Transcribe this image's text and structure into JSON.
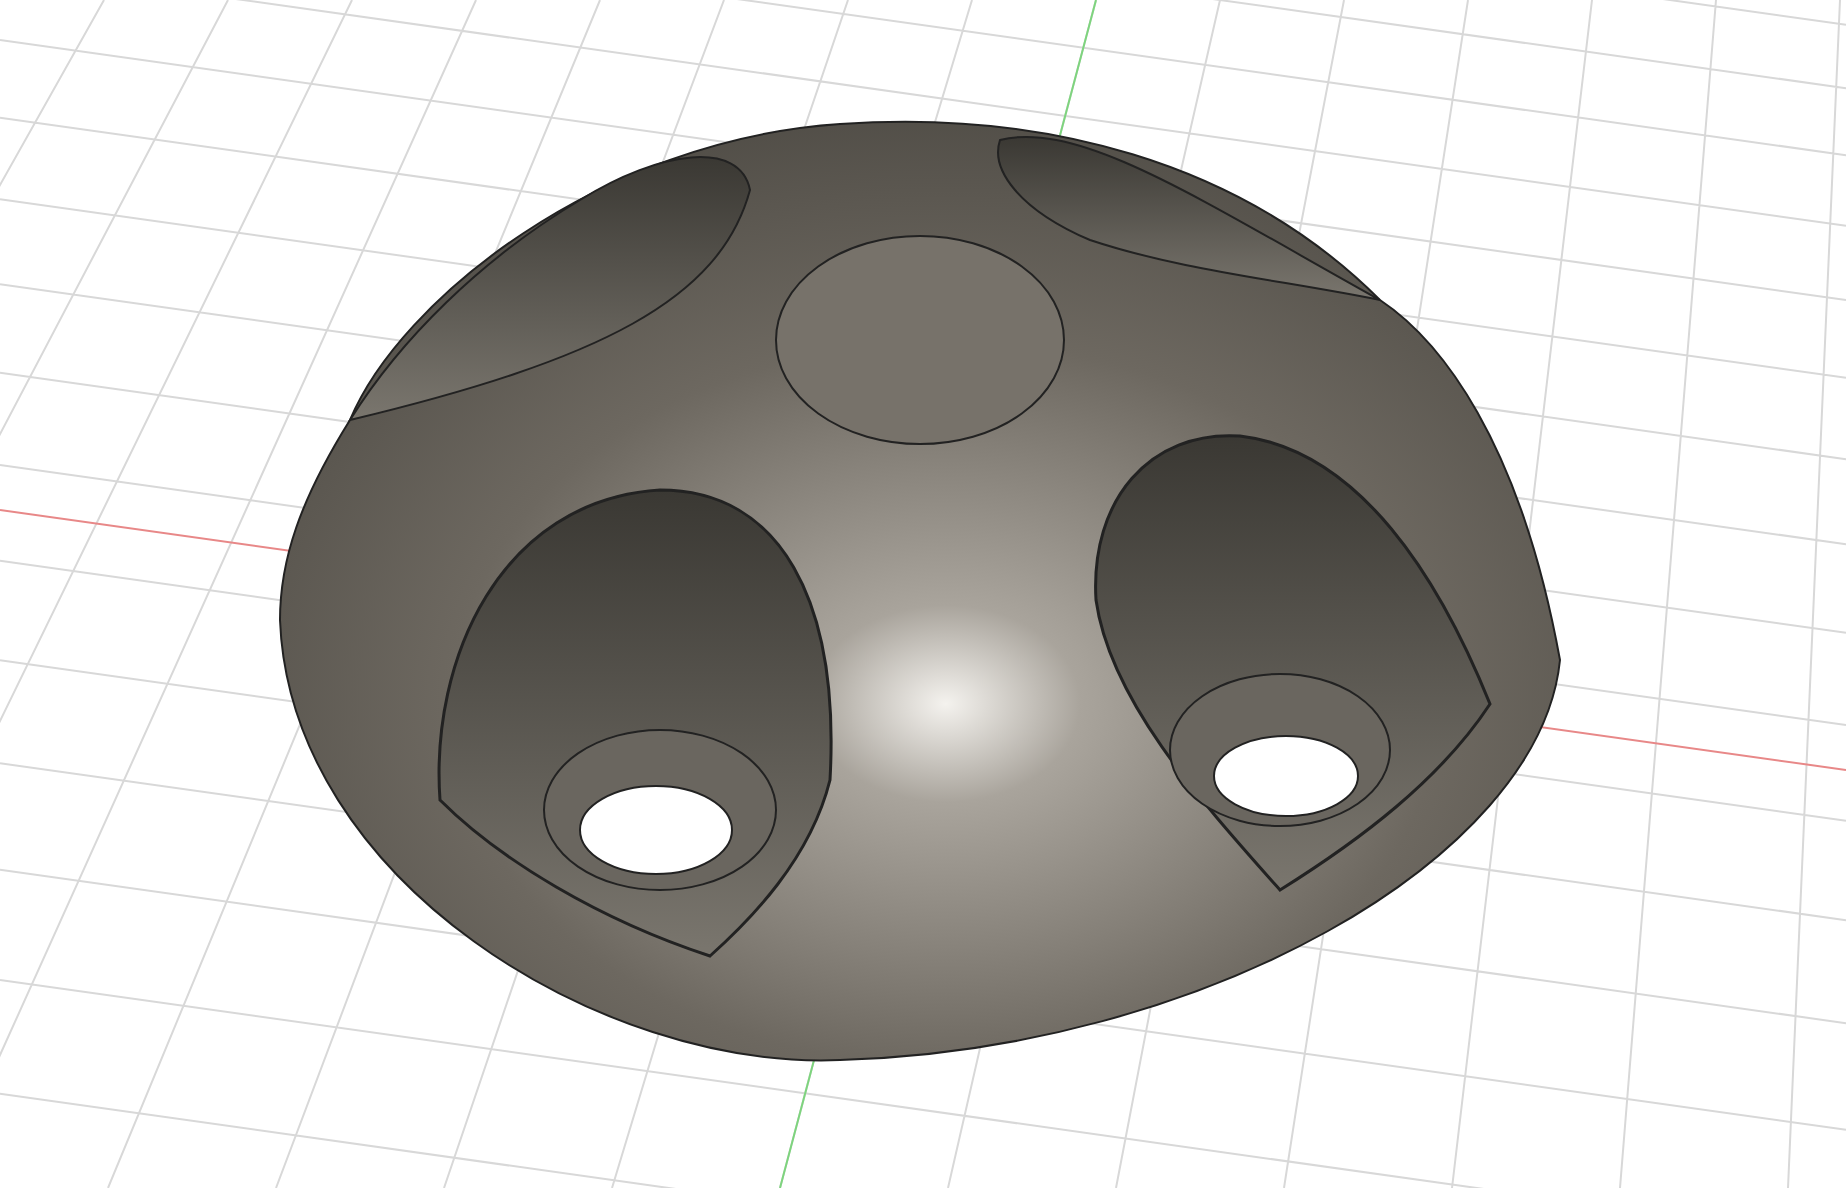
{
  "viewport": {
    "grid_visible": true
  }
}
